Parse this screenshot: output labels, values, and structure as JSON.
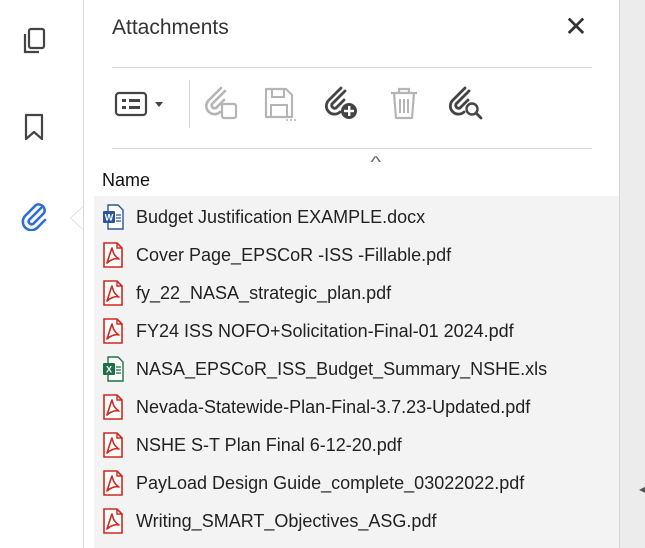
{
  "rail": {
    "items": [
      {
        "name": "pages-icon",
        "active": false
      },
      {
        "name": "bookmark-icon",
        "active": false
      },
      {
        "name": "attachment-icon",
        "active": true
      }
    ]
  },
  "panel": {
    "title": "Attachments",
    "close_symbol": "✕",
    "toolbar": [
      {
        "name": "options-menu-button",
        "icon": "list-options-icon",
        "enabled": true
      },
      {
        "name": "open-attachment-button",
        "icon": "open-attachment-icon",
        "enabled": false
      },
      {
        "name": "save-attachment-button",
        "icon": "save-icon",
        "enabled": false
      },
      {
        "name": "add-attachment-button",
        "icon": "add-attachment-icon",
        "enabled": true
      },
      {
        "name": "delete-attachment-button",
        "icon": "trash-icon",
        "enabled": false
      },
      {
        "name": "search-attachment-button",
        "icon": "search-attachment-icon",
        "enabled": true
      }
    ],
    "column_header": "Name",
    "sort_caret": "^"
  },
  "files": [
    {
      "name": "Budget Justification EXAMPLE.docx",
      "type": "word"
    },
    {
      "name": "Cover Page_EPSCoR -ISS -Fillable.pdf",
      "type": "pdf"
    },
    {
      "name": "fy_22_NASA_strategic_plan.pdf",
      "type": "pdf"
    },
    {
      "name": "FY24 ISS NOFO+Solicitation-Final-01 2024.pdf",
      "type": "pdf"
    },
    {
      "name": "NASA_EPSCoR_ISS_Budget_Summary_NSHE.xls",
      "type": "excel"
    },
    {
      "name": "Nevada-Statewide-Plan-Final-3.7.23-Updated.pdf",
      "type": "pdf"
    },
    {
      "name": "NSHE S-T Plan Final 6-12-20.pdf",
      "type": "pdf"
    },
    {
      "name": "PayLoad Design Guide_complete_03022022.pdf",
      "type": "pdf"
    },
    {
      "name": "Writing_SMART_Objectives_ASG.pdf",
      "type": "pdf"
    }
  ],
  "colors": {
    "accent": "#2d6fd6",
    "pdf_red": "#d0281e",
    "word_blue": "#2b579a",
    "excel_green": "#1e7145",
    "disabled": "#b5b5b5",
    "icon": "#444444"
  }
}
